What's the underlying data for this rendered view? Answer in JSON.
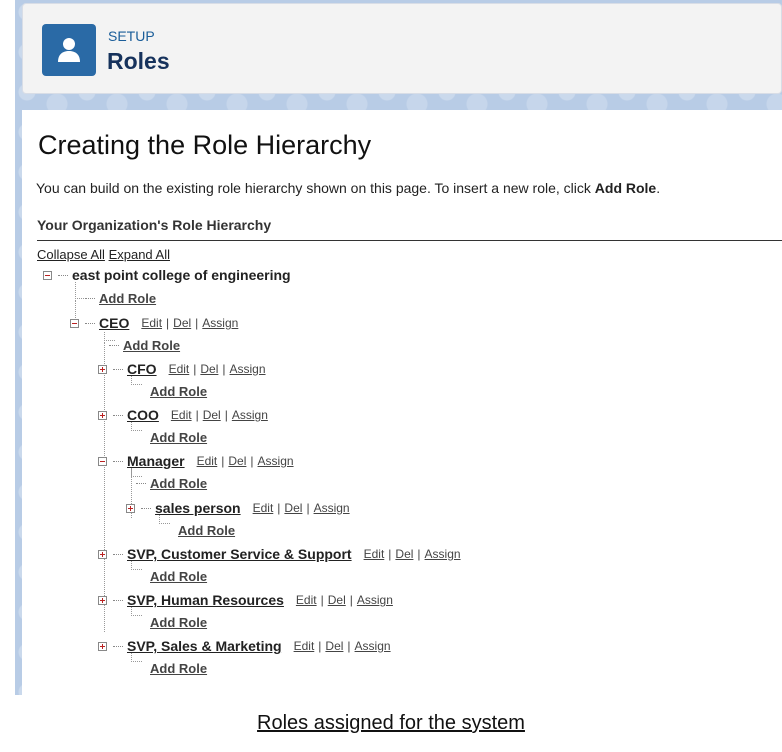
{
  "header": {
    "icon": "user-icon",
    "breadcrumb": "SETUP",
    "title": "Roles"
  },
  "main": {
    "title": "Creating the Role Hierarchy",
    "intro_text": "You can build on the existing role hierarchy shown on this page. To insert a new role, click ",
    "intro_bold": "Add Role",
    "intro_end": ".",
    "section_title": "Your Organization's Role Hierarchy",
    "collapse_all": "Collapse All",
    "expand_all": "Expand All"
  },
  "tree": {
    "root": "east point college of engineering",
    "add_role": "Add Role",
    "edit": "Edit",
    "del": "Del",
    "assign": "Assign",
    "sep": "|",
    "nodes": {
      "ceo": "CEO",
      "cfo": "CFO",
      "coo": "COO",
      "manager": "Manager",
      "sales_person": "sales person",
      "svp_cs": "SVP, Customer Service & Support",
      "svp_hr": "SVP, Human Resources",
      "svp_sm": "SVP, Sales & Marketing"
    }
  },
  "caption": "Roles assigned for the system"
}
